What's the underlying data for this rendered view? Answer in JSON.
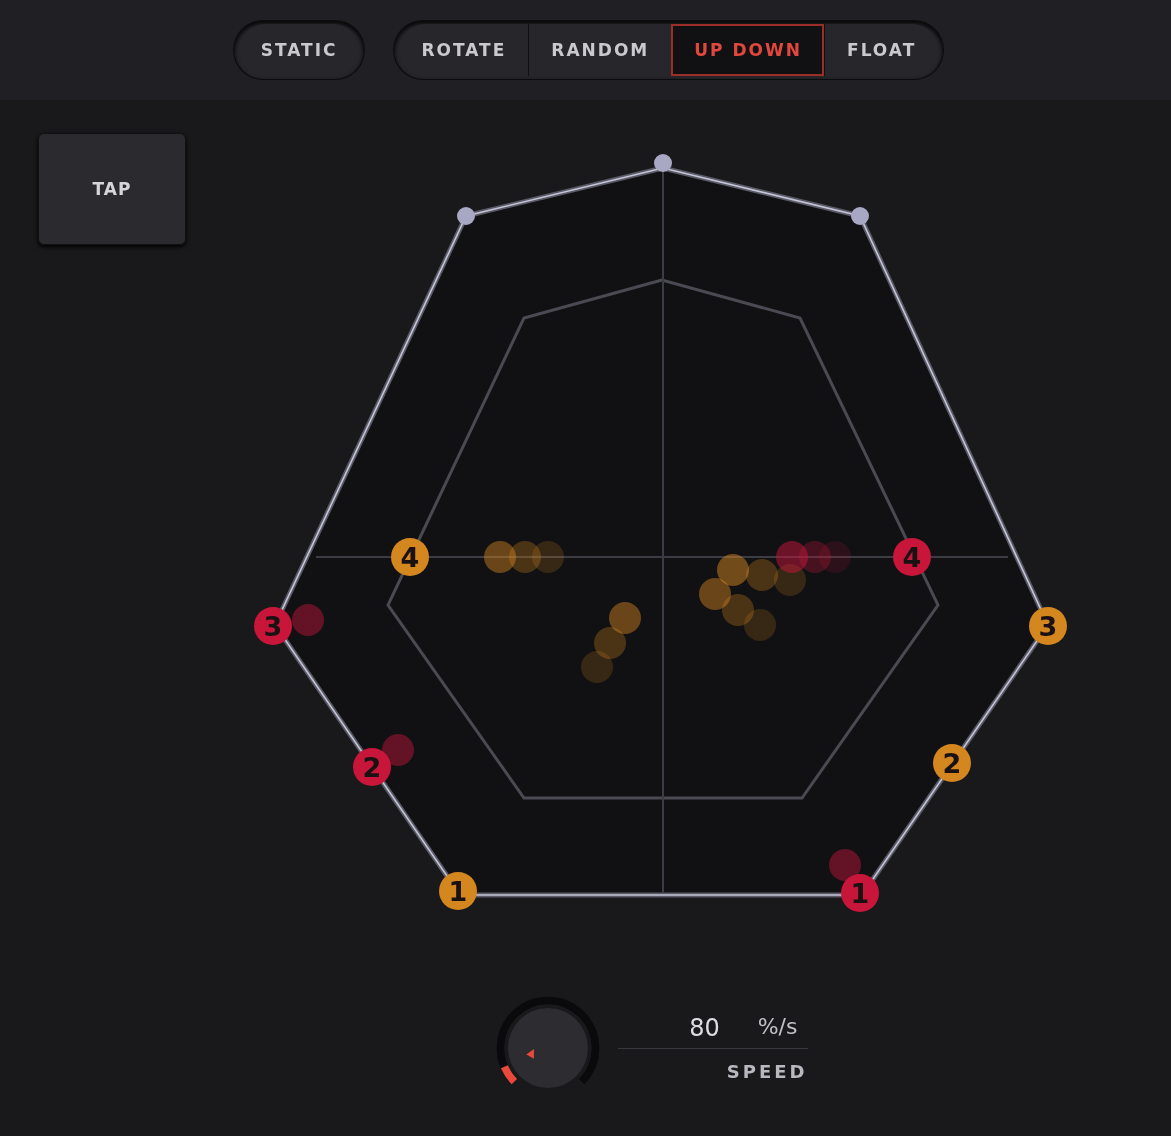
{
  "mode_groups": [
    [
      {
        "label": "STATIC",
        "selected": false
      }
    ],
    [
      {
        "label": "ROTATE",
        "selected": false
      },
      {
        "label": "RANDOM",
        "selected": false
      },
      {
        "label": "UP DOWN",
        "selected": true
      },
      {
        "label": "FLOAT",
        "selected": false
      }
    ]
  ],
  "tap_button": "TAP",
  "markers": [
    {
      "label": "4",
      "color": "#d4861f"
    },
    {
      "label": "4",
      "color": "#c8163a"
    },
    {
      "label": "3",
      "color": "#c8163a"
    },
    {
      "label": "3",
      "color": "#d4861f"
    },
    {
      "label": "2",
      "color": "#c8163a"
    },
    {
      "label": "2",
      "color": "#d4861f"
    },
    {
      "label": "1",
      "color": "#d4861f"
    },
    {
      "label": "1",
      "color": "#c8163a"
    }
  ],
  "speed": {
    "value": "80",
    "unit": "%/s",
    "label": "SPEED"
  }
}
